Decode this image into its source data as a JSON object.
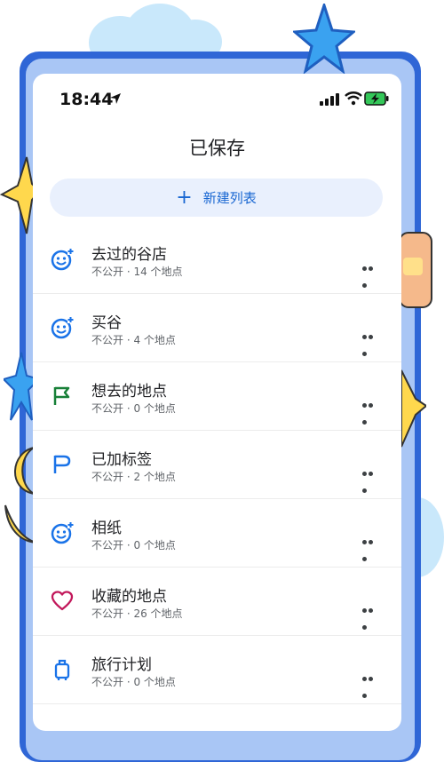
{
  "status_bar": {
    "time": "18:44"
  },
  "page": {
    "title": "已保存"
  },
  "new_list": {
    "label": "新建列表"
  },
  "lists": [
    {
      "title": "去过的谷店",
      "visibility": "不公开",
      "count": "14 个地点",
      "icon": "smiley-plus-icon"
    },
    {
      "title": "买谷",
      "visibility": "不公开",
      "count": "4 个地点",
      "icon": "smiley-plus-icon"
    },
    {
      "title": "想去的地点",
      "visibility": "不公开",
      "count": "0 个地点",
      "icon": "green-flag-icon"
    },
    {
      "title": "已加标签",
      "visibility": "不公开",
      "count": "2 个地点",
      "icon": "label-flag-icon"
    },
    {
      "title": "相纸",
      "visibility": "不公开",
      "count": "0 个地点",
      "icon": "smiley-plus-icon"
    },
    {
      "title": "收藏的地点",
      "visibility": "不公开",
      "count": "26 个地点",
      "icon": "heart-icon"
    },
    {
      "title": "旅行计划",
      "visibility": "不公开",
      "count": "0 个地点",
      "icon": "suitcase-icon"
    }
  ],
  "colors": {
    "accent": "#1967d2",
    "new_list_bg": "#e9f0fd",
    "frame": "#2f66d6"
  }
}
